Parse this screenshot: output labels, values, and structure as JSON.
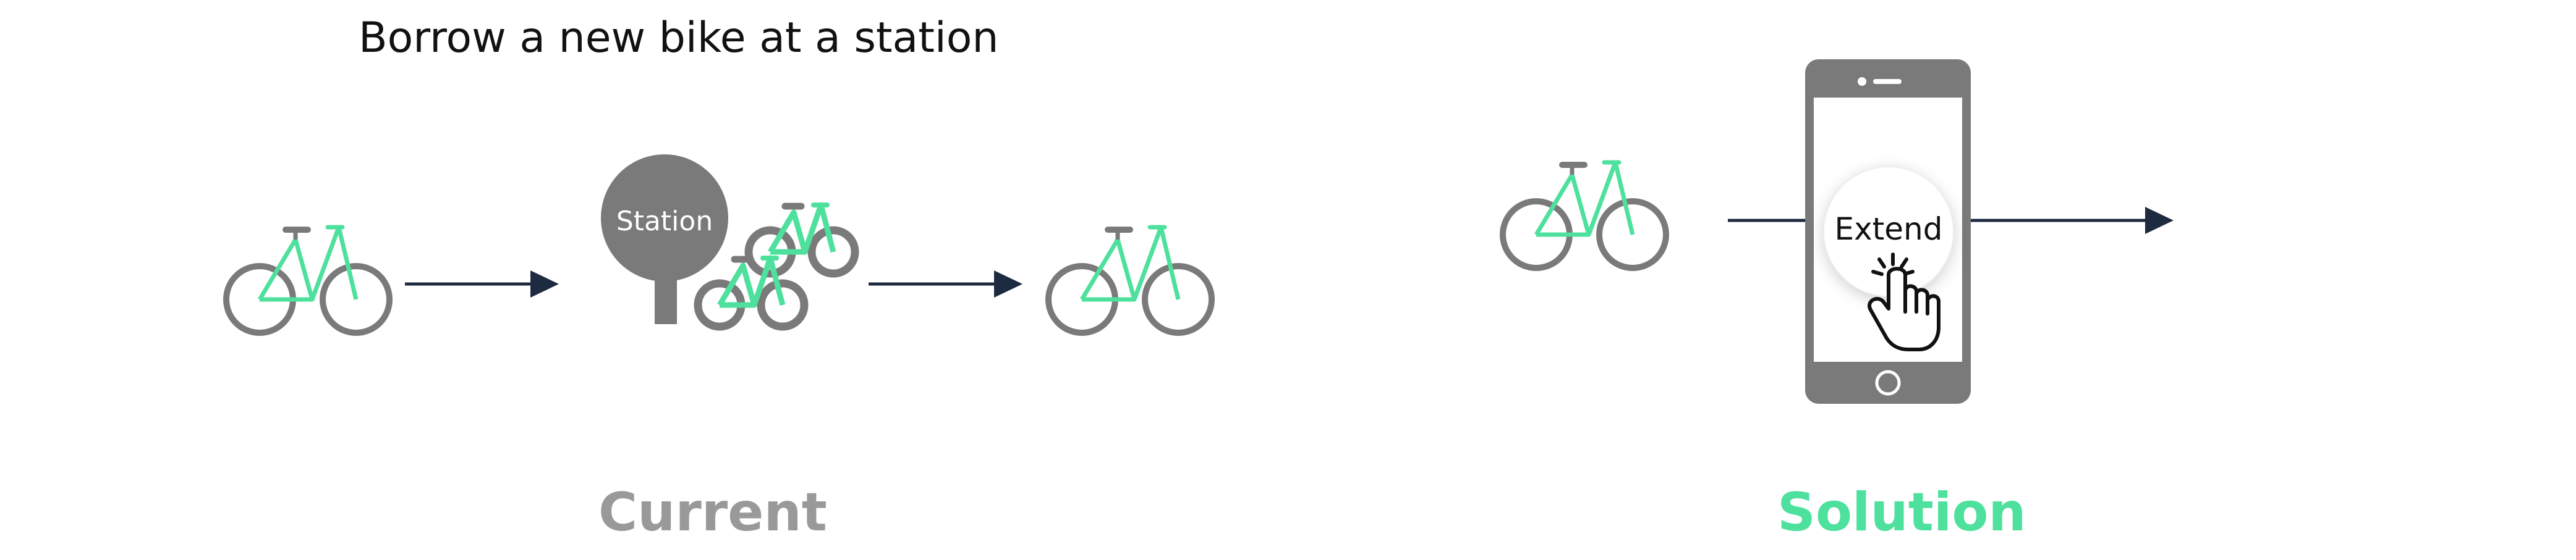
{
  "header": {
    "title": "Borrow a new bike at a station"
  },
  "current": {
    "station_label": "Station",
    "caption": "Current"
  },
  "solution": {
    "button_label": "Extend",
    "caption": "Solution"
  },
  "colors": {
    "bike_frame": "#4ee09d",
    "gray": "#7a7a7a",
    "arrow": "#1e2a40",
    "current_caption": "#999999",
    "solution_caption": "#4ee09d"
  },
  "icons": [
    "bike-icon",
    "arrow-icon",
    "station-sign-icon",
    "phone-icon",
    "tap-hand-icon"
  ]
}
